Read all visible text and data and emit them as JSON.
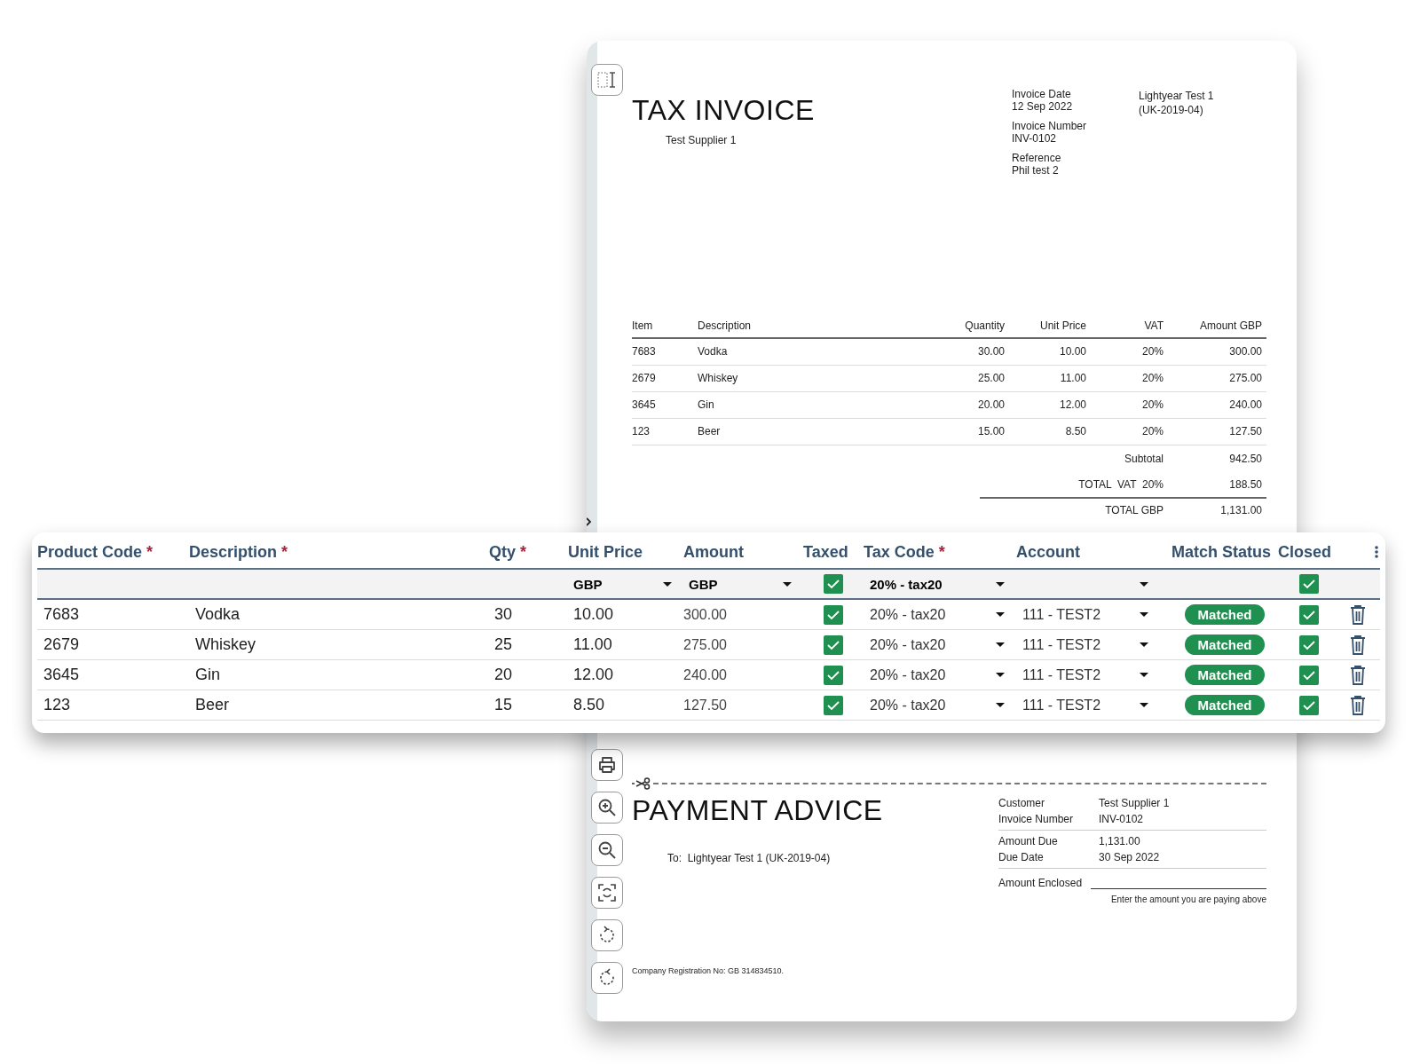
{
  "document": {
    "invoice": {
      "title": "TAX INVOICE",
      "supplier": "Test Supplier 1",
      "meta": [
        {
          "label": "Invoice Date",
          "value": "12 Sep 2022"
        },
        {
          "label": "Invoice Number",
          "value": "INV-0102"
        },
        {
          "label": "Reference",
          "value": "Phil test 2"
        }
      ],
      "customer": [
        "Lightyear Test 1",
        "(UK-2019-04)"
      ],
      "columns": [
        "Item",
        "Description",
        "Quantity",
        "Unit Price",
        "VAT",
        "Amount GBP"
      ],
      "rows": [
        [
          "7683",
          "Vodka",
          "30.00",
          "10.00",
          "20%",
          "300.00"
        ],
        [
          "2679",
          "Whiskey",
          "25.00",
          "11.00",
          "20%",
          "275.00"
        ],
        [
          "3645",
          "Gin",
          "20.00",
          "12.00",
          "20%",
          "240.00"
        ],
        [
          "123",
          "Beer",
          "15.00",
          "8.50",
          "20%",
          "127.50"
        ]
      ],
      "totals": [
        {
          "label": "Subtotal",
          "value": "942.50",
          "ruled": false
        },
        {
          "label": "TOTAL  VAT  20%",
          "value": "188.50",
          "ruled": false
        },
        {
          "label": "TOTAL GBP",
          "value": "1,131.00",
          "ruled": true
        }
      ]
    },
    "payment_advice": {
      "title": "PAYMENT ADVICE",
      "to": "To:  Lightyear Test 1 (UK-2019-04)",
      "details": [
        [
          {
            "label": "Customer",
            "value": "Test Supplier 1"
          },
          {
            "label": "Invoice Number",
            "value": "INV-0102"
          }
        ],
        [
          {
            "label": "Amount Due",
            "value": "1,131.00"
          },
          {
            "label": "Due Date",
            "value": "30 Sep 2022"
          }
        ]
      ],
      "enclosed_label": "Amount Enclosed",
      "enclosed_hint": "Enter the amount you are paying above"
    },
    "registration": "Company Registration No: GB 314834510."
  },
  "lines": {
    "columns": [
      {
        "label": "Product Code",
        "mark": "*"
      },
      {
        "label": "Description",
        "mark": "*"
      },
      {
        "label": "Qty",
        "mark": "*"
      },
      {
        "label": "Unit Price"
      },
      {
        "label": "Amount"
      },
      {
        "label": "Taxed"
      },
      {
        "label": "Tax Code",
        "mark": "*"
      },
      {
        "label": "Account"
      },
      {
        "label": "Match Status"
      },
      {
        "label": "Closed"
      }
    ],
    "filters": {
      "unit_price_currency": "GBP",
      "amount_currency": "GBP",
      "taxed": true,
      "tax_code": "20% - tax20",
      "closed": true
    },
    "rows": [
      {
        "product_code": "7683",
        "description": "Vodka",
        "qty": "30",
        "unit_price": "10.00",
        "amount": "300.00",
        "taxed": true,
        "tax_code": "20% - tax20",
        "account": "111 - TEST2",
        "match_status": "Matched",
        "closed": true
      },
      {
        "product_code": "2679",
        "description": "Whiskey",
        "qty": "25",
        "unit_price": "11.00",
        "amount": "275.00",
        "taxed": true,
        "tax_code": "20% - tax20",
        "account": "111 - TEST2",
        "match_status": "Matched",
        "closed": true
      },
      {
        "product_code": "3645",
        "description": "Gin",
        "qty": "20",
        "unit_price": "12.00",
        "amount": "240.00",
        "taxed": true,
        "tax_code": "20% - tax20",
        "account": "111 - TEST2",
        "match_status": "Matched",
        "closed": true
      },
      {
        "product_code": "123",
        "description": "Beer",
        "qty": "15",
        "unit_price": "8.50",
        "amount": "127.50",
        "taxed": true,
        "tax_code": "20% - tax20",
        "account": "111 - TEST2",
        "match_status": "Matched",
        "closed": true
      }
    ]
  }
}
